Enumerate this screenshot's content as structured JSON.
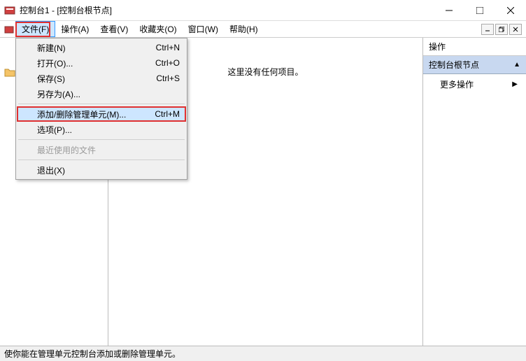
{
  "window": {
    "title": "控制台1 - [控制台根节点]"
  },
  "menu": {
    "items": [
      "文件(F)",
      "操作(A)",
      "查看(V)",
      "收藏夹(O)",
      "窗口(W)",
      "帮助(H)"
    ]
  },
  "file_menu": {
    "new": "新建(N)",
    "new_sc": "Ctrl+N",
    "open": "打开(O)...",
    "open_sc": "Ctrl+O",
    "save": "保存(S)",
    "save_sc": "Ctrl+S",
    "saveas": "另存为(A)...",
    "addremove": "添加/删除管理单元(M)...",
    "addremove_sc": "Ctrl+M",
    "options": "选项(P)...",
    "recent": "最近使用的文件",
    "exit": "退出(X)"
  },
  "main": {
    "empty": "这里没有任何项目。"
  },
  "actions": {
    "header": "操作",
    "node": "控制台根节点",
    "more": "更多操作"
  },
  "status": "使你能在管理单元控制台添加或删除管理单元。"
}
